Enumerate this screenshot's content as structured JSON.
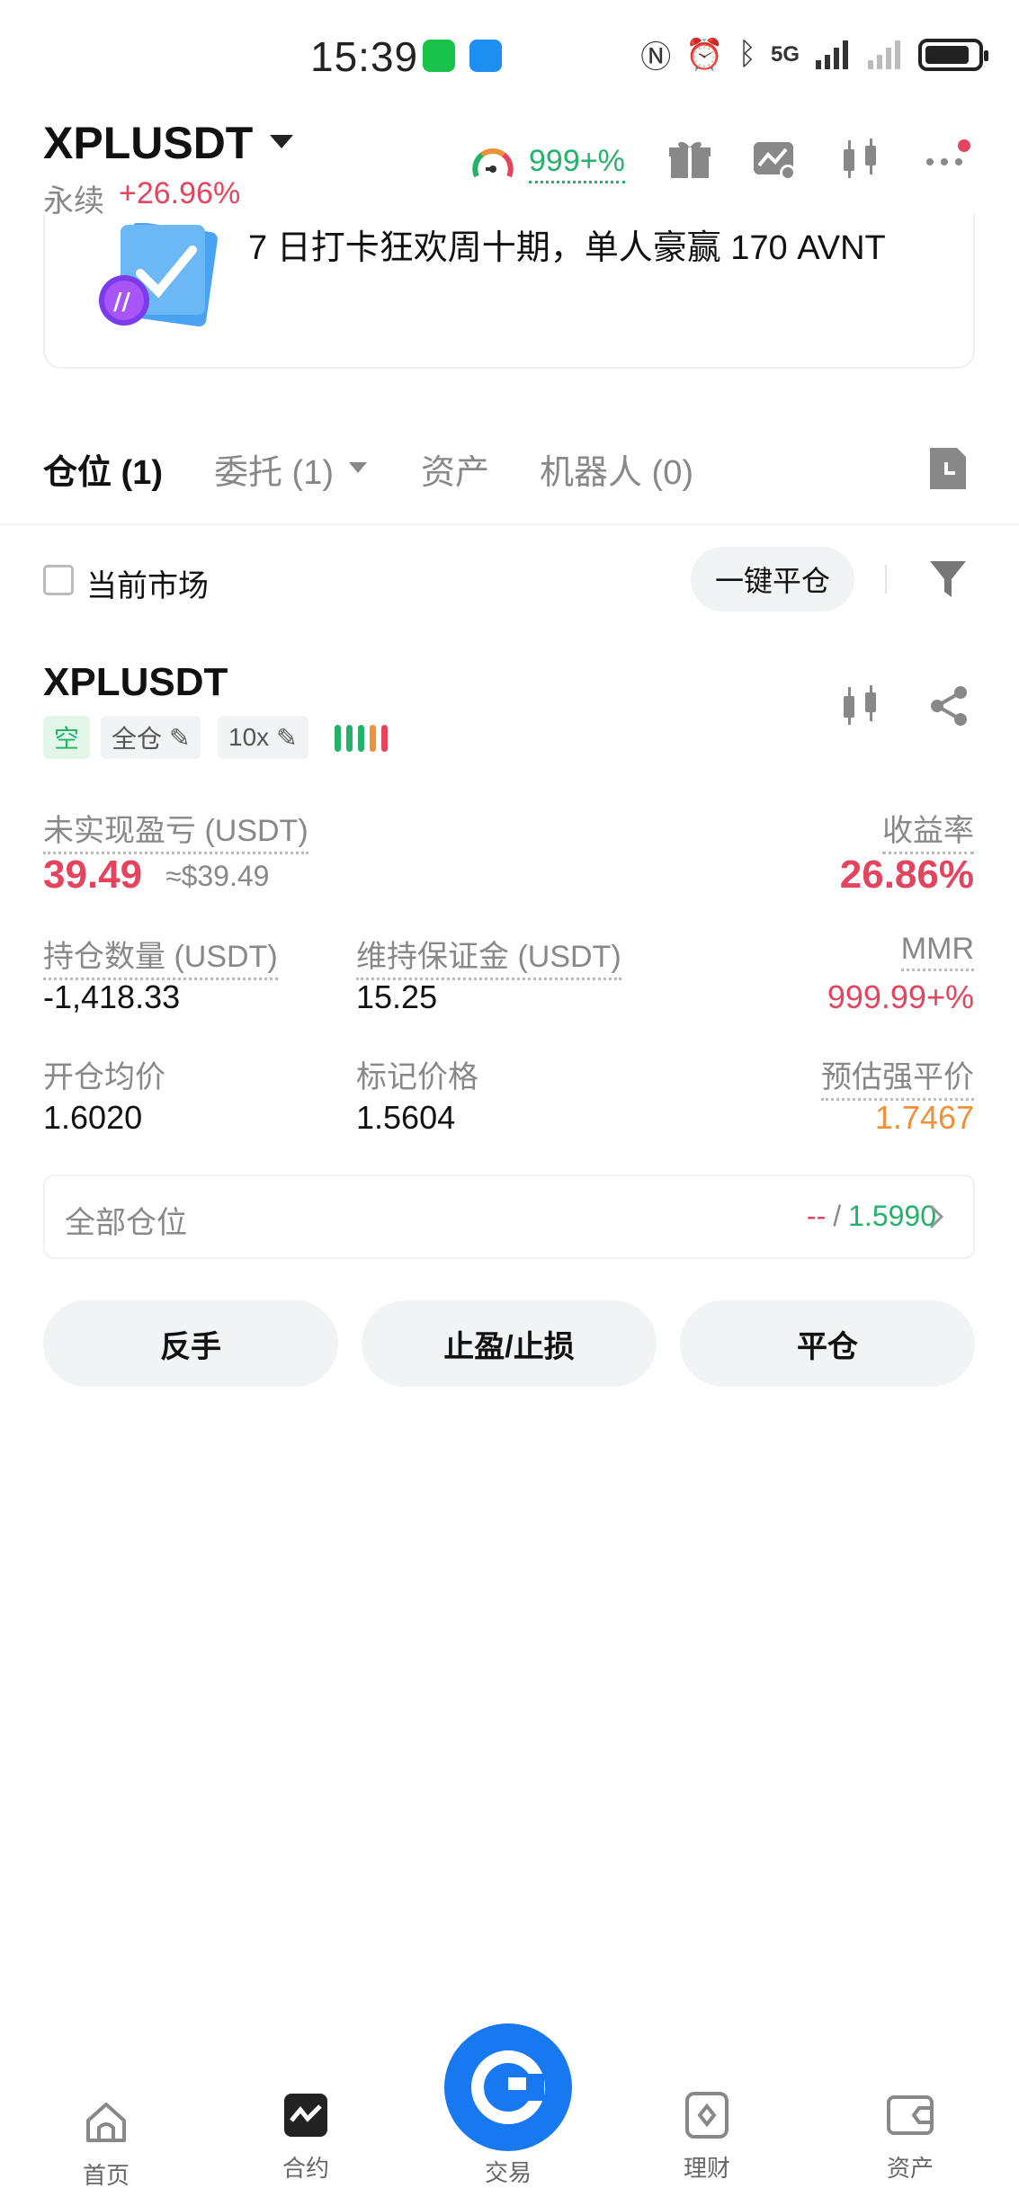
{
  "status_bar": {
    "time": "15:39",
    "network": "5G"
  },
  "header": {
    "pair": "XPLUSDT",
    "contract_type": "永续",
    "change": "+26.96%",
    "gauge_value": "999+%"
  },
  "banner": {
    "text": "7 日打卡狂欢周十期，单人豪赢 170 AVNT"
  },
  "tabs": [
    {
      "label": "仓位 (1)"
    },
    {
      "label": "委托 (1)"
    },
    {
      "label": "资产"
    },
    {
      "label": "机器人 (0)"
    }
  ],
  "filter": {
    "current_market_label": "当前市场",
    "close_all_label": "一键平仓"
  },
  "position": {
    "symbol": "XPLUSDT",
    "side_tag": "空",
    "margin_mode_tag": "全仓",
    "leverage_tag": "10x",
    "unrealized_pnl_label": "未实现盈亏 (USDT)",
    "unrealized_pnl": "39.49",
    "unrealized_pnl_usd": "≈$39.49",
    "roe_label": "收益率",
    "roe": "26.86%",
    "size_label": "持仓数量 (USDT)",
    "size": "-1,418.33",
    "maint_margin_label": "维持保证金 (USDT)",
    "maint_margin": "15.25",
    "mmr_label": "MMR",
    "mmr": "999.99+%",
    "entry_price_label": "开仓均价",
    "entry_price": "1.6020",
    "mark_price_label": "标记价格",
    "mark_price": "1.5604",
    "liq_price_label": "预估强平价",
    "liq_price": "1.7467",
    "all_positions_label": "全部仓位",
    "all_positions_left": "--",
    "all_positions_sep": "/",
    "all_positions_right": "1.5990"
  },
  "actions": {
    "reverse": "反手",
    "tpsl": "止盈/止损",
    "close": "平仓"
  },
  "nav": [
    {
      "label": "首页",
      "icon": "home-icon"
    },
    {
      "label": "合约",
      "icon": "futures-icon"
    },
    {
      "label": "交易",
      "icon": "trade-icon"
    },
    {
      "label": "理财",
      "icon": "earn-icon"
    },
    {
      "label": "资产",
      "icon": "wallet-icon"
    }
  ],
  "colors": {
    "red": "#e5445e",
    "green": "#24b26b",
    "orange": "#f0913a",
    "brand_blue": "#1878f0"
  }
}
